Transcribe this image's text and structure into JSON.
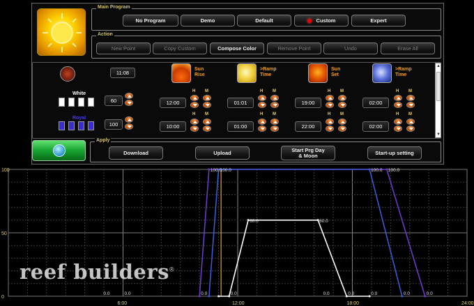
{
  "main_program": {
    "title": "Main Program",
    "buttons": [
      {
        "label": "No Program"
      },
      {
        "label": "Demo"
      },
      {
        "label": "Default"
      },
      {
        "label": "Custom",
        "selected": true
      },
      {
        "label": "Expert"
      }
    ]
  },
  "action": {
    "title": "Action",
    "buttons": [
      {
        "label": "New Point",
        "enabled": false
      },
      {
        "label": "Copy Custom",
        "enabled": false
      },
      {
        "label": "Compose Color",
        "enabled": true
      },
      {
        "label": "Remove Point",
        "enabled": false
      },
      {
        "label": "Undo",
        "enabled": false
      },
      {
        "label": "Erase All",
        "enabled": false
      }
    ]
  },
  "settings": {
    "clock_time": "11:08",
    "white_label": "White",
    "white_value": "60",
    "royal_label": "Royal",
    "royal_value": "100",
    "hm_h": "H",
    "hm_m": "M",
    "columns": [
      {
        "icon": "sunrise-icon",
        "label": "Sun Rise",
        "time1": "12:00",
        "time2": "10:00"
      },
      {
        "icon": "ramp-time-icon",
        "label": ">Ramp Time",
        "time1": "01:01",
        "time2": "01:00"
      },
      {
        "icon": "sunset-icon",
        "label": "Sun Set",
        "time1": "19:00",
        "time2": "22:00"
      },
      {
        "icon": "moon-ramp-icon",
        "label": ">Ramp Time",
        "time1": "02:00",
        "time2": "02:00"
      }
    ]
  },
  "apply": {
    "title": "Apply",
    "buttons": [
      {
        "label": "Download"
      },
      {
        "label": "Upload"
      },
      {
        "label": "Start Prg Day & Moon"
      },
      {
        "label": "Start-up setting"
      }
    ]
  },
  "watermark": {
    "text": "reef builders",
    "mark": "®"
  },
  "colors": {
    "accent": "#f0a020",
    "white_channel": "#ffffff",
    "royal_channel": "#3a2ad8",
    "blue_line": "#3a5ad8",
    "purple_line": "#6a3ac8"
  },
  "chart_data": {
    "type": "line",
    "xlim": [
      0,
      24
    ],
    "ylim": [
      0,
      100
    ],
    "x_ticks": [
      "0",
      "6:00",
      "12:00",
      "18:00",
      "24:00"
    ],
    "y_ticks": [
      "0",
      "50",
      "100"
    ],
    "grid": true,
    "series": [
      {
        "color": "#6a3ac8",
        "points": [
          [
            10.0,
            0
          ],
          [
            10.5,
            100
          ],
          [
            19.8,
            100
          ],
          [
            21.8,
            0
          ]
        ]
      },
      {
        "color": "#3a5ad8",
        "points": [
          [
            10.5,
            0
          ],
          [
            11.0,
            100
          ],
          [
            18.9,
            100
          ],
          [
            20.6,
            0
          ]
        ]
      },
      {
        "color": "#ffffff",
        "points": [
          [
            11.0,
            0
          ],
          [
            11.55,
            0
          ],
          [
            12.55,
            60
          ],
          [
            16.2,
            60
          ],
          [
            17.7,
            0
          ],
          [
            18.9,
            0
          ]
        ]
      }
    ],
    "point_labels": [
      {
        "x": 10.5,
        "y": 100,
        "text": "100.0"
      },
      {
        "x": 11.0,
        "y": 100,
        "text": "100.0"
      },
      {
        "x": 18.9,
        "y": 100,
        "text": "100.0"
      },
      {
        "x": 19.8,
        "y": 100,
        "text": "100.0"
      },
      {
        "x": 12.55,
        "y": 60,
        "text": "60.0"
      },
      {
        "x": 16.2,
        "y": 60,
        "text": "60.0"
      },
      {
        "x": 4.9,
        "y": 0,
        "text": "0.0"
      },
      {
        "x": 6.0,
        "y": 0,
        "text": "0.0"
      },
      {
        "x": 10.0,
        "y": 0,
        "text": "0.0"
      },
      {
        "x": 11.55,
        "y": 0,
        "text": "0.0"
      },
      {
        "x": 16.4,
        "y": 0,
        "text": "0.0"
      },
      {
        "x": 17.7,
        "y": 0,
        "text": "0.0"
      },
      {
        "x": 18.9,
        "y": 0,
        "text": "0.0"
      },
      {
        "x": 20.6,
        "y": 0,
        "text": "0.0"
      },
      {
        "x": 21.8,
        "y": 0,
        "text": "0.0"
      }
    ]
  }
}
